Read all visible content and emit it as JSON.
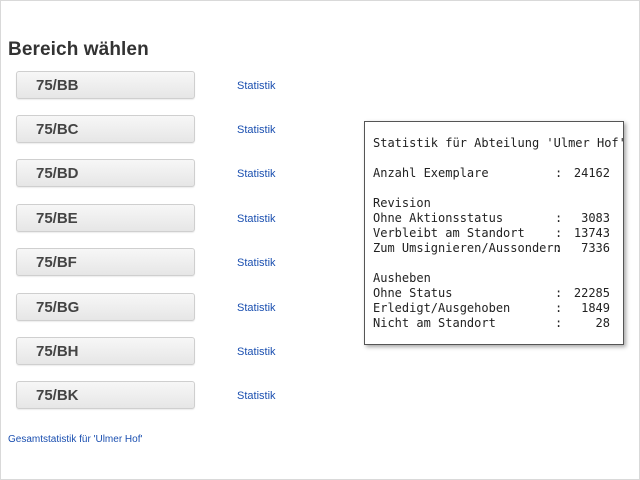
{
  "page": {
    "title": "Bereich wählen"
  },
  "areas": [
    {
      "code": "75/BB",
      "link": "Statistik"
    },
    {
      "code": "75/BC",
      "link": "Statistik"
    },
    {
      "code": "75/BD",
      "link": "Statistik"
    },
    {
      "code": "75/BE",
      "link": "Statistik"
    },
    {
      "code": "75/BF",
      "link": "Statistik"
    },
    {
      "code": "75/BG",
      "link": "Statistik"
    },
    {
      "code": "75/BH",
      "link": "Statistik"
    },
    {
      "code": "75/BK",
      "link": "Statistik"
    }
  ],
  "total_link": "Gesamtstatistik für 'Ulmer Hof'",
  "stats": {
    "heading": "Statistik für Abteilung 'Ulmer Hof'",
    "copies": {
      "label": "Anzahl Exemplare",
      "value": "24162"
    },
    "revision": {
      "heading": "Revision",
      "rows": [
        {
          "label": "Ohne Aktionsstatus",
          "value": "3083"
        },
        {
          "label": "Verbleibt am Standort",
          "value": "13743"
        },
        {
          "label": "Zum Umsignieren/Aussondern",
          "value": "7336"
        }
      ]
    },
    "ausheben": {
      "heading": "Ausheben",
      "rows": [
        {
          "label": "Ohne Status",
          "value": "22285"
        },
        {
          "label": "Erledigt/Ausgehoben",
          "value": "1849"
        },
        {
          "label": "Nicht am Standort",
          "value": "28"
        }
      ]
    }
  }
}
